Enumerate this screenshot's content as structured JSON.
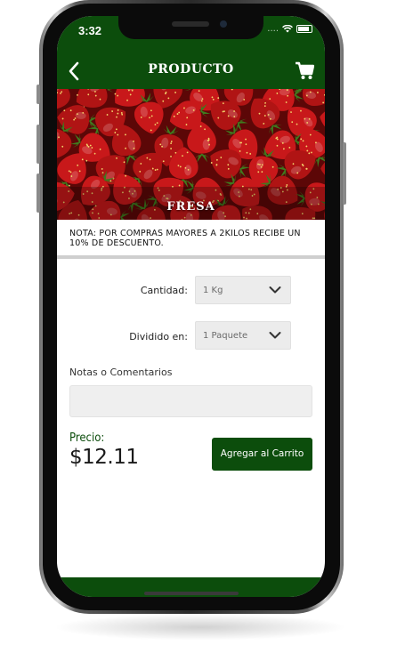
{
  "status_bar": {
    "time": "3:32",
    "signal": "....",
    "icons": [
      "wifi-icon",
      "battery-icon"
    ]
  },
  "header": {
    "title": "PRODUCTO",
    "back_icon": "chevron-left-icon",
    "cart_icon": "cart-icon"
  },
  "product": {
    "name": "FRESA",
    "image": "strawberries"
  },
  "note": {
    "text": "NOTA: POR COMPRAS MAYORES A 2KILOS RECIBE UN 10% DE DESCUENTO."
  },
  "form": {
    "quantity_label": "Cantidad:",
    "quantity_value": "1 Kg",
    "divided_label": "Dividido en:",
    "divided_value": "1 Paquete",
    "notes_label": "Notas o Comentarios",
    "notes_value": ""
  },
  "price": {
    "label": "Precio:",
    "value": "$12.11"
  },
  "actions": {
    "add_to_cart": "Agregar al Carrito"
  },
  "colors": {
    "primary": "#0c4d0c",
    "accent_red": "#b01414"
  }
}
